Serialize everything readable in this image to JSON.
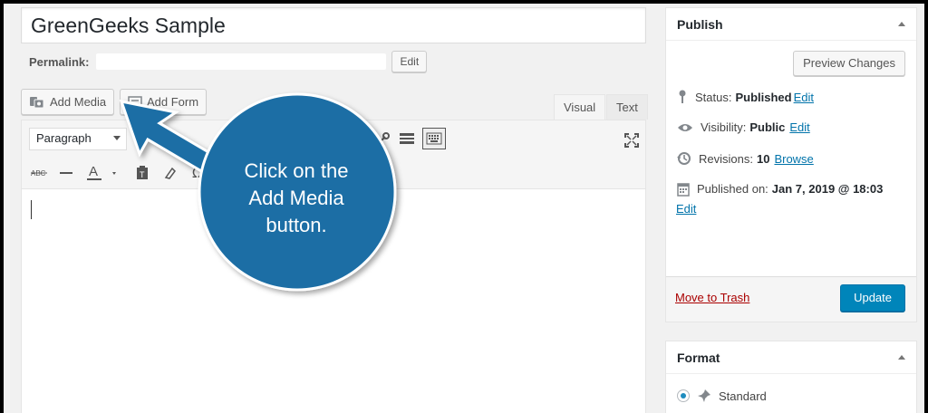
{
  "post": {
    "title": "GreenGeeks Sample",
    "permalink_label": "Permalink:",
    "permalink_edit": "Edit"
  },
  "media_buttons": {
    "add_media": "Add Media",
    "add_form": "Add Form"
  },
  "editor": {
    "tab_visual": "Visual",
    "tab_text": "Text",
    "format_select_value": "Paragraph"
  },
  "publish": {
    "title": "Publish",
    "preview": "Preview Changes",
    "status_label": "Status:",
    "status_value": "Published",
    "status_edit": "Edit",
    "visibility_label": "Visibility:",
    "visibility_value": "Public",
    "visibility_edit": "Edit",
    "revisions_label": "Revisions:",
    "revisions_value": "10",
    "revisions_browse": "Browse",
    "published_label": "Published on:",
    "published_value": "Jan 7, 2019 @ 18:03",
    "published_edit": "Edit",
    "trash": "Move to Trash",
    "update": "Update"
  },
  "format_box": {
    "title": "Format",
    "option_standard": "Standard"
  },
  "callout": {
    "line1": "Click on the",
    "line2": "Add Media",
    "line3": "button."
  },
  "colors": {
    "callout": "#1a6ea5",
    "primary": "#0085ba",
    "link": "#0073aa",
    "trash": "#a00000"
  }
}
